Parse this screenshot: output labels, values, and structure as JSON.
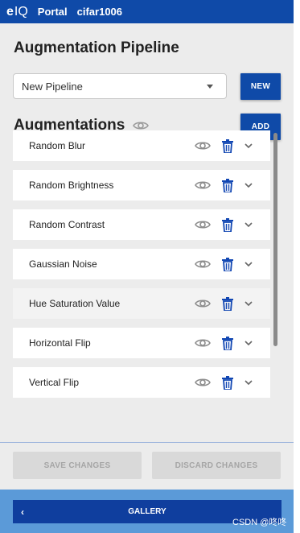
{
  "topbar": {
    "logo_e": "e",
    "logo_iq": "IQ",
    "portal": "Portal",
    "project": "cifar1006"
  },
  "pipeline": {
    "title": "Augmentation Pipeline",
    "selected": "New Pipeline",
    "new_label": "NEW"
  },
  "augmentations": {
    "title": "Augmentations",
    "add_label": "ADD",
    "items": [
      {
        "label": "Random Blur"
      },
      {
        "label": "Random Brightness"
      },
      {
        "label": "Random Contrast"
      },
      {
        "label": "Gaussian Noise"
      },
      {
        "label": "Hue Saturation Value"
      },
      {
        "label": "Horizontal Flip"
      },
      {
        "label": "Vertical Flip"
      }
    ]
  },
  "footer": {
    "save_label": "SAVE CHANGES",
    "discard_label": "DISCARD CHANGES",
    "gallery_label": "GALLERY",
    "back_symbol": "‹"
  },
  "watermark": "CSDN @咚咚",
  "colors": {
    "brand_blue": "#0f4aa8",
    "trash_blue": "#1247b3"
  }
}
